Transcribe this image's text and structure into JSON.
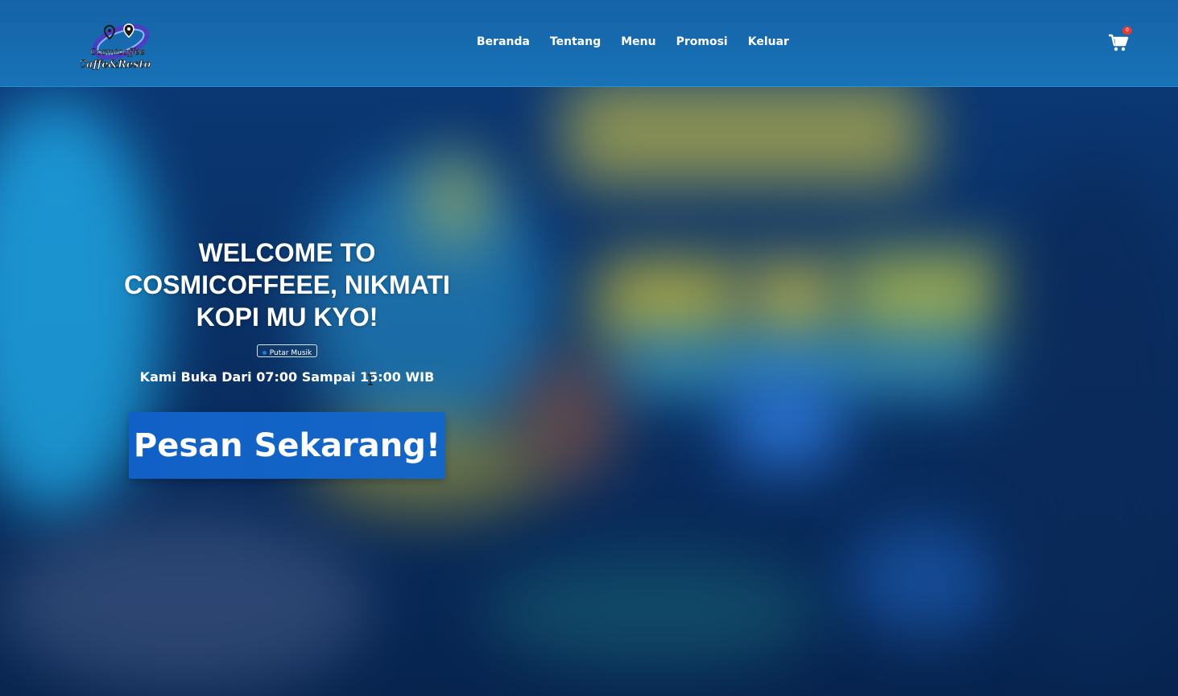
{
  "brand": {
    "logo_text_line1": "Cosmicoffee",
    "logo_text_line2": "Caffe&Resto"
  },
  "nav": {
    "items": [
      {
        "label": "Beranda"
      },
      {
        "label": "Tentang"
      },
      {
        "label": "Menu"
      },
      {
        "label": "Promosi"
      },
      {
        "label": "Keluar"
      }
    ]
  },
  "cart": {
    "icon": "cart-icon",
    "count": "0"
  },
  "hero": {
    "title": "WELCOME TO COSMICOFFEEE, NIKMATI KOPI MU KYO!",
    "music_button_label": "Putar Musik",
    "hours_text": "Kami Buka Dari 07:00 Sampai 15:00 WIB",
    "order_button_label": "Pesan Sekarang!"
  },
  "colors": {
    "navbar": "#1873b6",
    "order_button": "#1466c6",
    "cart_badge": "#e53935",
    "text": "#ffffff"
  }
}
